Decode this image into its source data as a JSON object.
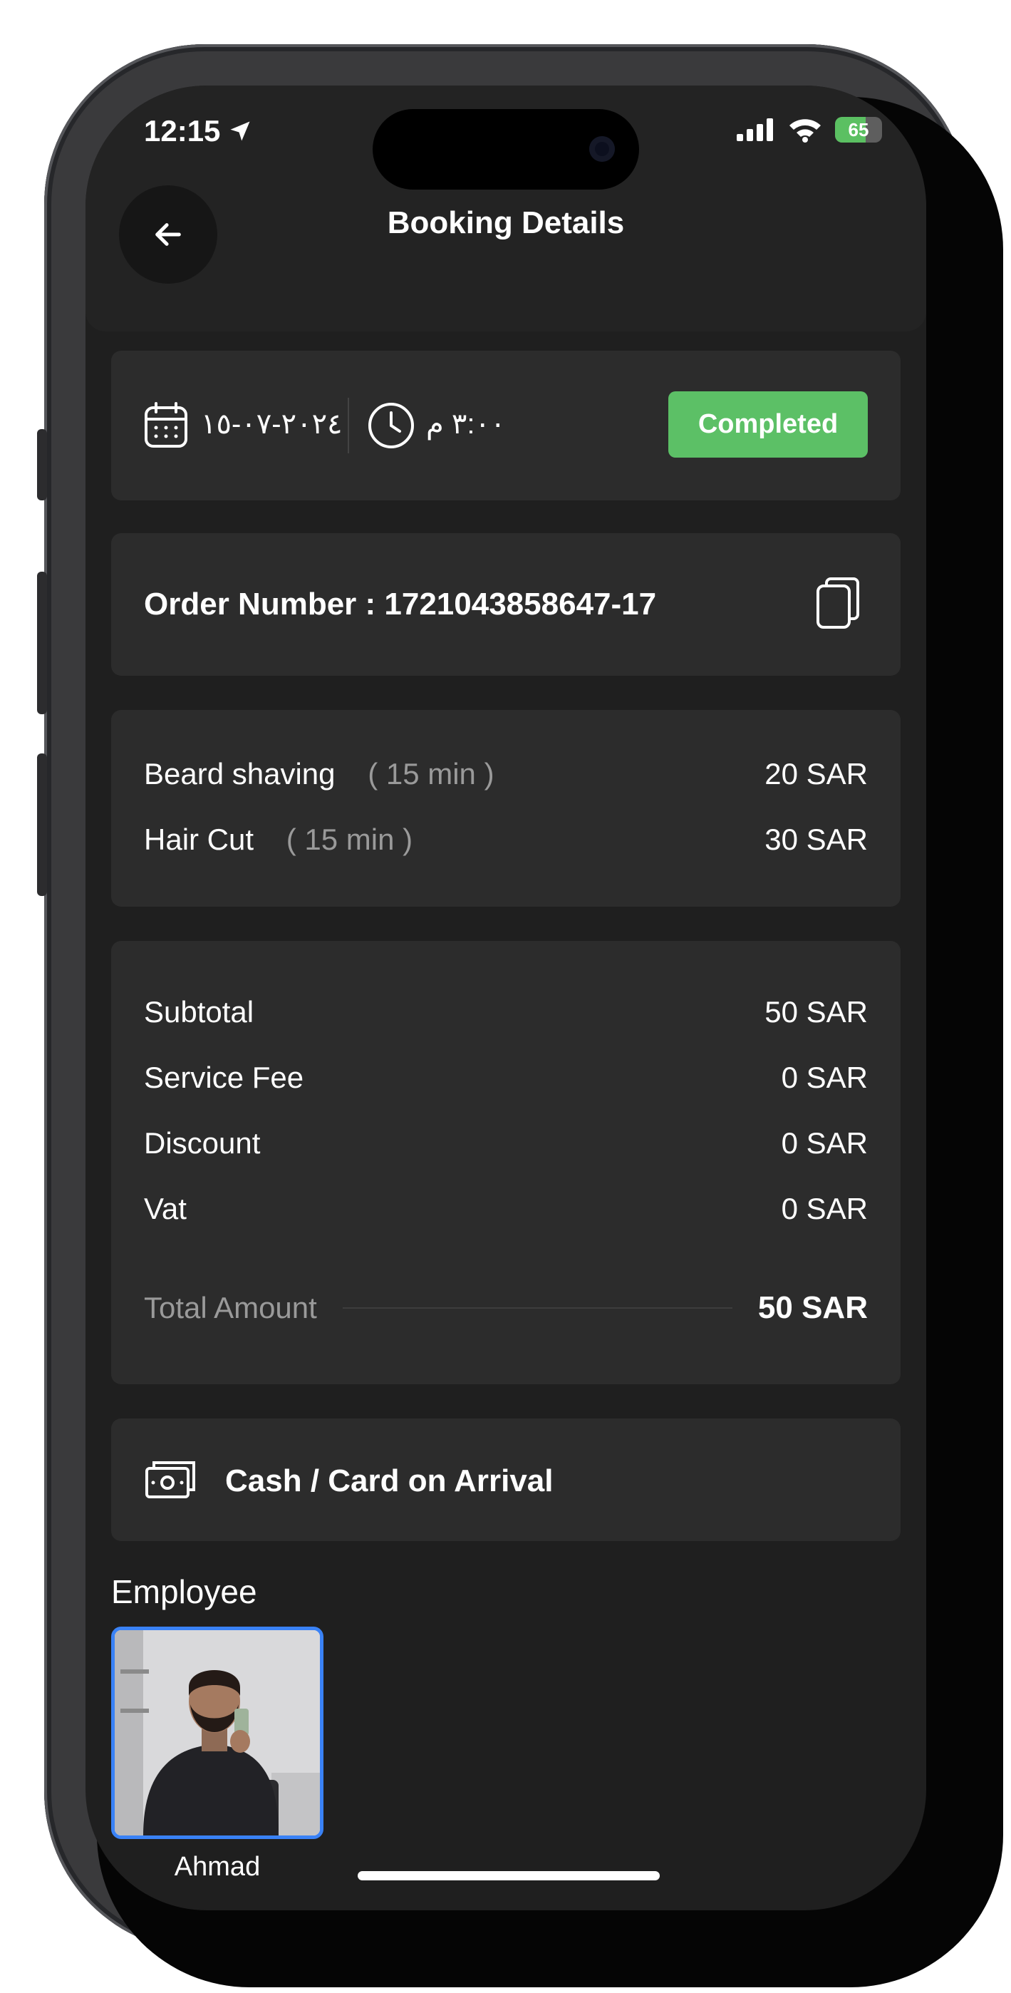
{
  "status_bar": {
    "time": "12:15",
    "battery": "65",
    "battery_level": 0.65
  },
  "header": {
    "title": "Booking Details"
  },
  "booking": {
    "date": "٢٠٢٤-٠٧-١٥",
    "time": "٣:٠٠ م",
    "status": "Completed"
  },
  "order": {
    "label": "Order Number : 1721043858647-17"
  },
  "services": [
    {
      "name": "Beard shaving",
      "duration": "( 15 min )",
      "price": "20 SAR"
    },
    {
      "name": "Hair Cut",
      "duration": "( 15 min )",
      "price": "30 SAR"
    }
  ],
  "summary": {
    "rows": [
      {
        "label": "Subtotal",
        "value": "50 SAR"
      },
      {
        "label": "Service Fee",
        "value": "0 SAR"
      },
      {
        "label": "Discount",
        "value": "0 SAR"
      },
      {
        "label": "Vat",
        "value": "0 SAR"
      }
    ],
    "total_label": "Total Amount",
    "total_value": "50 SAR"
  },
  "payment": {
    "method": "Cash / Card on Arrival"
  },
  "employee": {
    "section_title": "Employee",
    "name": "Ahmad"
  },
  "colors": {
    "accent_green": "#5cc066",
    "selected_border": "#3a82f6",
    "background": "#1f1f1f",
    "card": "#2c2c2c"
  }
}
